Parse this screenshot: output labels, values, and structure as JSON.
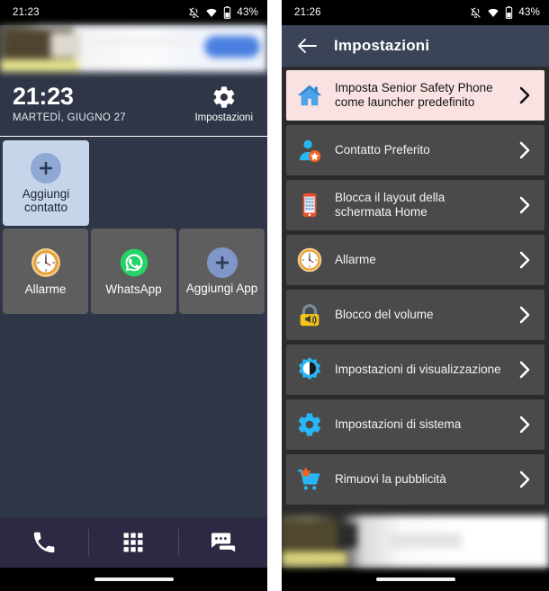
{
  "left_phone": {
    "status_bar": {
      "time": "21:23",
      "battery_pct": "43%",
      "icons": [
        "notifications-muted-icon",
        "wifi-icon",
        "battery-icon"
      ]
    },
    "ad_banner": {
      "name": "advertisement-banner-blurred"
    },
    "clock_widget": {
      "time": "21:23",
      "date": "MARTEDÌ, GIUGNO 27",
      "settings_label": "Impostazioni"
    },
    "contact_tiles": [
      {
        "label": "Aggiungi contatto",
        "icon": "plus-icon",
        "type": "add-contact"
      }
    ],
    "app_tiles": [
      {
        "label": "Allarme",
        "icon": "alarm-clock-icon"
      },
      {
        "label": "WhatsApp",
        "icon": "whatsapp-icon"
      },
      {
        "label": "Aggiungi App",
        "icon": "plus-icon"
      }
    ],
    "nav_bar": [
      {
        "name": "phone-icon",
        "label": "Telefono"
      },
      {
        "name": "apps-grid-icon",
        "label": "App"
      },
      {
        "name": "messages-icon",
        "label": "Messaggi"
      }
    ]
  },
  "right_phone": {
    "status_bar": {
      "time": "21:26",
      "battery_pct": "43%",
      "icons": [
        "notifications-muted-icon",
        "wifi-icon",
        "battery-icon"
      ]
    },
    "app_bar": {
      "back_icon": "back-arrow-icon",
      "title": "Impostazioni"
    },
    "settings_items": [
      {
        "label": "Imposta Senior Safety Phone come launcher predefinito",
        "icon": "home-house-icon",
        "highlighted": true
      },
      {
        "label": "Contatto Preferito",
        "icon": "favorite-contact-icon",
        "highlighted": false
      },
      {
        "label": "Blocca il layout della schermata Home",
        "icon": "lock-home-layout-icon",
        "highlighted": false
      },
      {
        "label": "Allarme",
        "icon": "alarm-clock-icon",
        "highlighted": false
      },
      {
        "label": "Blocco del volume",
        "icon": "volume-lock-icon",
        "highlighted": false
      },
      {
        "label": "Impostazioni di visualizzazione",
        "icon": "display-brightness-icon",
        "highlighted": false
      },
      {
        "label": "Impostazioni di sistema",
        "icon": "gear-icon",
        "highlighted": false
      },
      {
        "label": "Rimuovi la pubblicità",
        "icon": "shopping-cart-star-icon",
        "highlighted": false
      }
    ],
    "bottom_ad": {
      "name": "advertisement-banner-blurred"
    }
  },
  "colors": {
    "home_background": "#2e3647",
    "contact_tile": "#c6d6ea",
    "app_tile": "#5e5e5e",
    "nav_bar": "#2b2a42",
    "settings_background": "#2b2b2b",
    "settings_row": "#4a4a4a",
    "settings_row_highlight": "#fbe2e2",
    "app_bar": "#3b4456",
    "accent_blue": "#29b6f6",
    "status_bar": "#000000"
  }
}
